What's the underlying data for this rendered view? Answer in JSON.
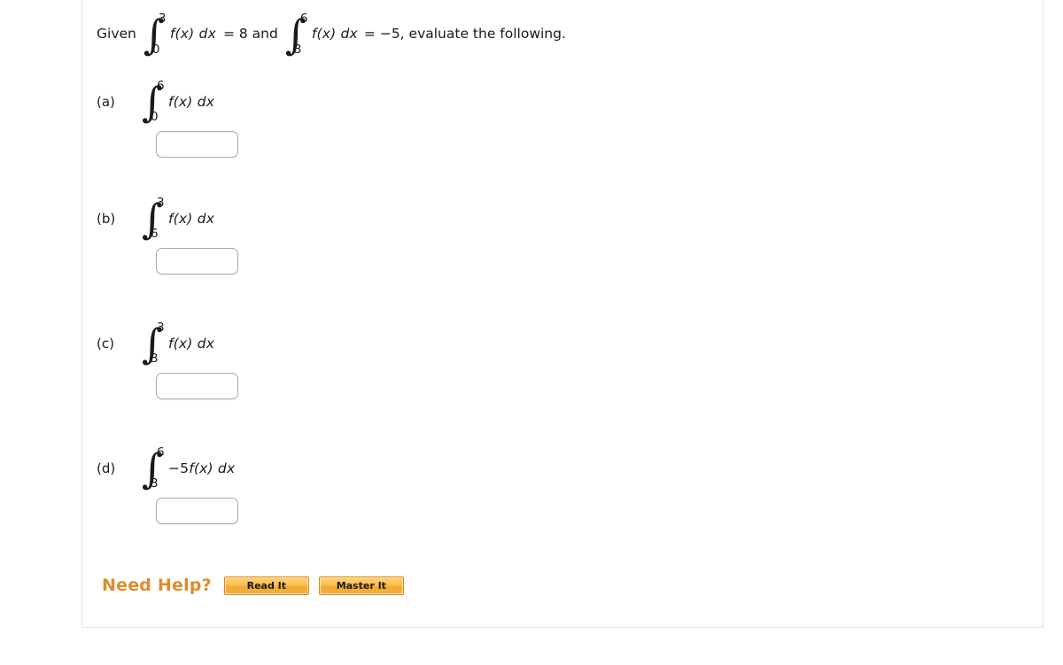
{
  "prompt": {
    "lead": "Given",
    "integral_1": {
      "lower": "0",
      "upper": "3",
      "integrand_fn": "f(x)",
      "differential": "dx"
    },
    "middle": "= 8 and",
    "integral_2": {
      "lower": "3",
      "upper": "6",
      "integrand_fn": "f(x)",
      "differential": "dx"
    },
    "tail": "= −5, evaluate the following."
  },
  "parts": [
    {
      "label": "(a)",
      "integral": {
        "lower": "0",
        "upper": "6",
        "coefficient": "",
        "integrand_fn": "f(x)",
        "differential": "dx"
      },
      "answer_value": "",
      "answer_placeholder": ""
    },
    {
      "label": "(b)",
      "integral": {
        "lower": "6",
        "upper": "3",
        "coefficient": "",
        "integrand_fn": "f(x)",
        "differential": "dx"
      },
      "answer_value": "",
      "answer_placeholder": ""
    },
    {
      "label": "(c)",
      "integral": {
        "lower": "3",
        "upper": "3",
        "coefficient": "",
        "integrand_fn": "f(x)",
        "differential": "dx"
      },
      "answer_value": "",
      "answer_placeholder": ""
    },
    {
      "label": "(d)",
      "integral": {
        "lower": "3",
        "upper": "6",
        "coefficient": "−5",
        "integrand_fn": "f(x)",
        "differential": "dx"
      },
      "answer_value": "",
      "answer_placeholder": ""
    }
  ],
  "footer": {
    "need_help_label": "Need Help?",
    "read_it_label": "Read It",
    "master_it_label": "Master It",
    "accent_color": "#e08b29",
    "button_border_color": "#d98a14"
  },
  "symbols": {
    "integral_glyph": "∫"
  }
}
